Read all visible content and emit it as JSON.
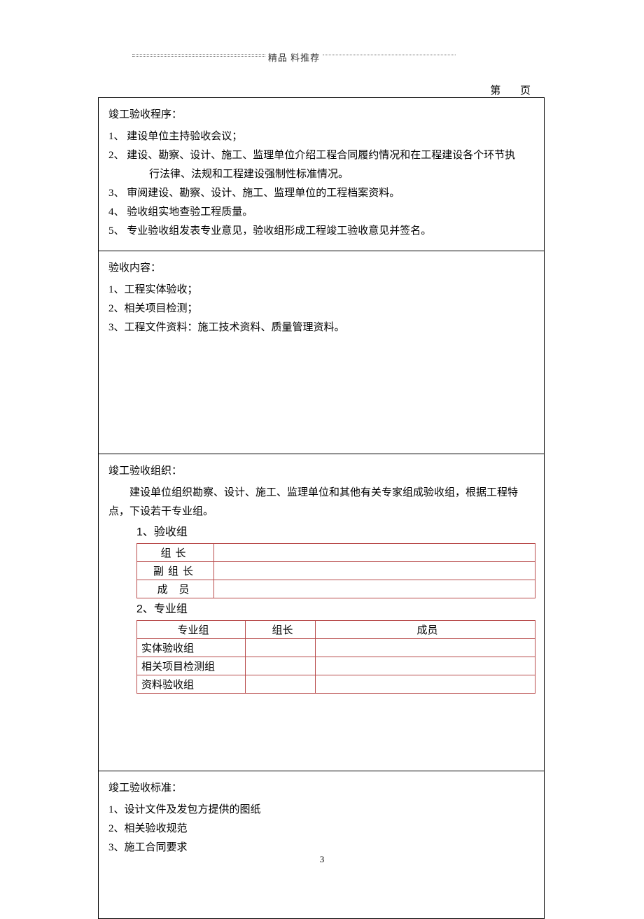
{
  "header": {
    "text": "精品  料推荐"
  },
  "page_label": "第 页",
  "section1": {
    "title": "竣工验收程序：",
    "items": [
      {
        "num": "1、",
        "text": "建设单位主持验收会议；"
      },
      {
        "num": "2、",
        "text": "建设、勘察、设计、施工、监理单位介绍工程合同履约情况和在工程建设各个环节执",
        "cont": "行法律、法规和工程建设强制性标准情况。"
      },
      {
        "num": "3、",
        "text": "审阅建设、勘察、设计、施工、监理单位的工程档案资料。"
      },
      {
        "num": "4、",
        "text": "验收组实地查验工程质量。"
      },
      {
        "num": "5、",
        "text": "专业验收组发表专业意见，验收组形成工程竣工验收意见并签名。"
      }
    ]
  },
  "section2": {
    "title": "验收内容：",
    "items": [
      {
        "num": "1、",
        "text": "工程实体验收；"
      },
      {
        "num": "2、",
        "text": "相关项目检测；"
      },
      {
        "num": "3、",
        "text": "工程文件资料：施工技术资料、质量管理资料。"
      }
    ]
  },
  "section3": {
    "title": "竣工验收组织：",
    "para": "建设单位组织勘察、设计、施工、监理单位和其他有关专家组成验收组，根据工程特",
    "para_cont": "点，下设若干专业组。",
    "table1_title": "1、验收组",
    "table1_rows": [
      {
        "label": "组长",
        "value": ""
      },
      {
        "label": "副组长",
        "value": ""
      },
      {
        "label": "成 员",
        "value": ""
      }
    ],
    "table2_title": "2、专业组",
    "table2_headers": [
      "专业组",
      "组长",
      "成员"
    ],
    "table2_rows": [
      {
        "c1": "实体验收组",
        "c2": "",
        "c3": ""
      },
      {
        "c1": "相关项目检测组",
        "c2": "",
        "c3": ""
      },
      {
        "c1": "资料验收组",
        "c2": "",
        "c3": ""
      }
    ]
  },
  "section4": {
    "title": "竣工验收标准：",
    "items": [
      {
        "num": "1、",
        "text": "设计文件及发包方提供的图纸"
      },
      {
        "num": "2、",
        "text": "相关验收规范"
      },
      {
        "num": "3、",
        "text": "施工合同要求"
      }
    ]
  },
  "page_number": "3"
}
